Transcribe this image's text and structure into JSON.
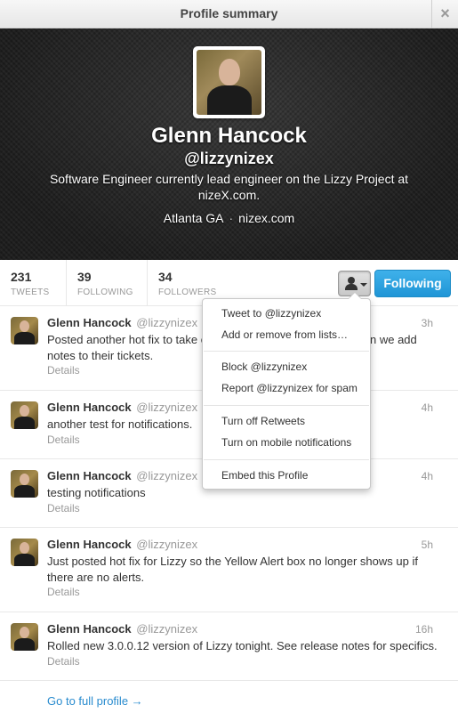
{
  "dialog": {
    "title": "Profile summary",
    "close_symbol": "×"
  },
  "profile": {
    "name": "Glenn Hancock",
    "handle": "@lizzynizex",
    "bio": "Software Engineer currently lead engineer on the Lizzy Project at nizeX.com.",
    "location": "Atlanta GA",
    "separator": "·",
    "website": "nizex.com"
  },
  "stats": {
    "tweets": {
      "count": "231",
      "label": "TWEETS"
    },
    "following": {
      "count": "39",
      "label": "FOLLOWING"
    },
    "followers": {
      "count": "34",
      "label": "FOLLOWERS"
    }
  },
  "actions": {
    "follow_label": "Following"
  },
  "menu": {
    "items": [
      "Tweet to @lizzynizex",
      "Add or remove from lists…",
      "Block @lizzynizex",
      "Report @lizzynizex for spam",
      "Turn off Retweets",
      "Turn on mobile notifications",
      "Embed this Profile"
    ]
  },
  "tweets": [
    {
      "name": "Glenn Hancock",
      "handle": "@lizzynizex",
      "time": "3h",
      "text": "Posted another hot fix to take ca",
      "text_tail": "n we add",
      "text_line2": "notes to their tickets.",
      "details": "Details"
    },
    {
      "name": "Glenn Hancock",
      "handle": "@lizzynizex",
      "time": "4h",
      "text": "another test for notifications.",
      "details": "Details"
    },
    {
      "name": "Glenn Hancock",
      "handle": "@lizzynizex",
      "time": "4h",
      "text": "testing notifications",
      "details": "Details"
    },
    {
      "name": "Glenn Hancock",
      "handle": "@lizzynizex",
      "time": "5h",
      "text": "Just posted hot fix for Lizzy so the Yellow Alert box no longer shows up if there are no alerts.",
      "details": "Details"
    },
    {
      "name": "Glenn Hancock",
      "handle": "@lizzynizex",
      "time": "16h",
      "text": "Rolled new 3.0.0.12 version of Lizzy tonight.  See release notes for specifics.",
      "details": "Details"
    }
  ],
  "footer": {
    "full_profile_link": "Go to full profile →"
  },
  "colors": {
    "accent": "#2a8ccf",
    "follow_button": "#2a9fe0"
  }
}
